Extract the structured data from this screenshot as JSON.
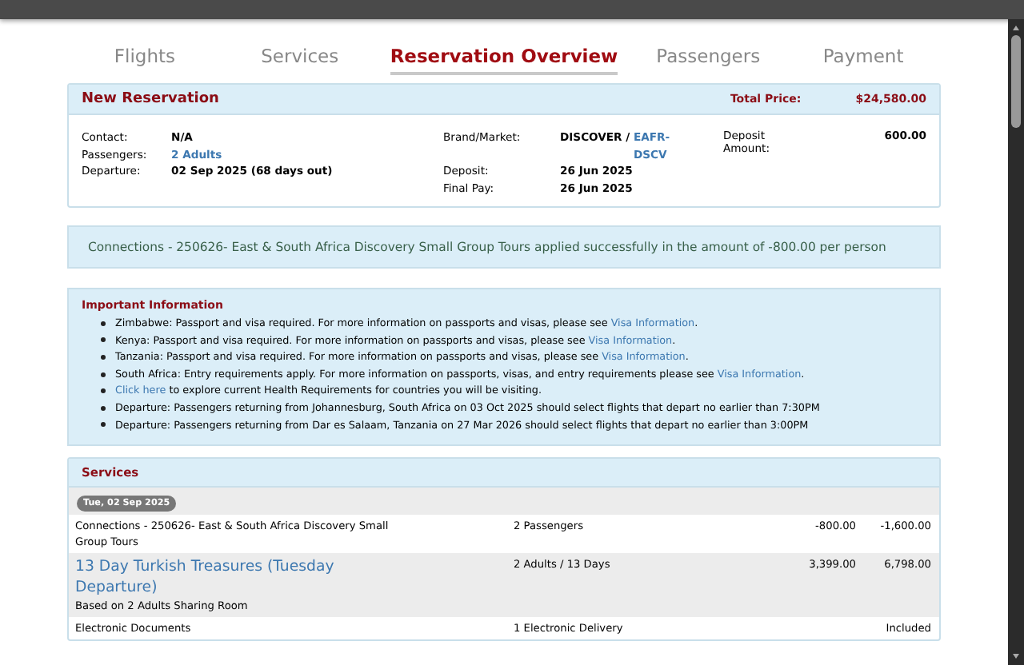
{
  "tabs": [
    {
      "label": "Flights",
      "selected": false
    },
    {
      "label": "Services",
      "selected": false
    },
    {
      "label": "Reservation Overview",
      "selected": true
    },
    {
      "label": "Passengers",
      "selected": false
    },
    {
      "label": "Payment",
      "selected": false
    }
  ],
  "reservation": {
    "title": "New Reservation",
    "total_label": "Total Price:",
    "total_value": "$24,580.00",
    "left": [
      {
        "label": "Contact:",
        "value": "N/A",
        "kind": "text"
      },
      {
        "label": "Passengers:",
        "value": "2 Adults",
        "kind": "link"
      },
      {
        "label": "Departure:",
        "value": "02 Sep 2025 (68 days out)",
        "kind": "text"
      }
    ],
    "brand": {
      "label": "Brand/Market:",
      "value": "DISCOVER /",
      "link": "EAFR-DSCV"
    },
    "dates": [
      {
        "label": "Deposit:",
        "value": "26 Jun 2025"
      },
      {
        "label": "Final Pay:",
        "value": "26 Jun 2025"
      }
    ],
    "deposit_amount": {
      "label": "Deposit Amount:",
      "value": "600.00"
    }
  },
  "alert": "Connections - 250626- East & South Africa Discovery Small Group Tours applied successfully in the amount of -800.00 per person",
  "important": {
    "title": "Important Information",
    "items": [
      [
        {
          "kind": "text",
          "text": "Zimbabwe: Passport and visa required. For more information on passports and visas, please see "
        },
        {
          "kind": "link",
          "text": "Visa Information"
        },
        {
          "kind": "text",
          "text": "."
        }
      ],
      [
        {
          "kind": "text",
          "text": "Kenya: Passport and visa required. For more information on passports and visas, please see "
        },
        {
          "kind": "link",
          "text": "Visa Information"
        },
        {
          "kind": "text",
          "text": "."
        }
      ],
      [
        {
          "kind": "text",
          "text": "Tanzania: Passport and visa required. For more information on passports and visas, please see "
        },
        {
          "kind": "link",
          "text": "Visa Information"
        },
        {
          "kind": "text",
          "text": "."
        }
      ],
      [
        {
          "kind": "text",
          "text": "South Africa: Entry requirements apply. For more information on passports, visas, and entry requirements please see "
        },
        {
          "kind": "link",
          "text": "Visa Information"
        },
        {
          "kind": "text",
          "text": "."
        }
      ],
      [
        {
          "kind": "link",
          "text": "Click here"
        },
        {
          "kind": "text",
          "text": " to explore current Health Requirements for countries you will be visiting."
        }
      ],
      [
        {
          "kind": "text",
          "text": "Departure: Passengers returning from Johannesburg, South Africa on 03 Oct 2025 should select flights that depart no earlier than 7:30PM"
        }
      ],
      [
        {
          "kind": "text",
          "text": "Departure: Passengers returning from Dar es Salaam, Tanzania on 27 Mar 2026 should select flights that depart no earlier than 3:00PM"
        }
      ]
    ]
  },
  "services": {
    "title": "Services",
    "date_badge": "Tue, 02 Sep 2025",
    "rows": [
      {
        "kind": "plain",
        "name": "Connections - 250626- East & South Africa Discovery Small Group Tours",
        "quantity": "2 Passengers",
        "unit_price": "-800.00",
        "total": "-1,600.00"
      },
      {
        "kind": "link",
        "name": "13 Day Turkish Treasures (Tuesday Departure)",
        "subtitle": "Based on 2 Adults Sharing Room",
        "quantity": "2 Adults / 13 Days",
        "unit_price": "3,399.00",
        "total": "6,798.00"
      },
      {
        "kind": "plain",
        "name": "Electronic Documents",
        "quantity": "1 Electronic Delivery",
        "total": "Included"
      }
    ]
  }
}
